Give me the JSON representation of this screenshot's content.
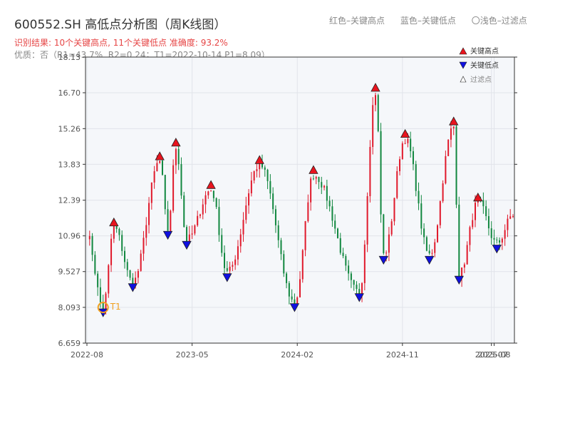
{
  "title": "600552.SH 高低点分析图（周K线图）",
  "subtitle": "识别结果: 10个关键高点, 11个关键低点  准确度: 93.2%",
  "quality_line": "优质：否（R1=43.7%, R2=0.24；T1=2022-10-14 P1=8.09）",
  "color_note": {
    "red": "红色–关键高点",
    "blue": "蓝色–关键低点",
    "light": "〇浅色–过滤点"
  },
  "colors": {
    "up": "#e0192b",
    "down": "#11873f",
    "high_marker": "#e8141e",
    "low_marker": "#1010e0",
    "t1": "#f0a020"
  },
  "chart_data": {
    "type": "candlestick",
    "title": "600552.SH 高低点分析图（周K线图）",
    "ylim": [
      6.659,
      18.13
    ],
    "yticks": [
      "6.659",
      "8.093",
      "9.527",
      "10.96",
      "12.39",
      "13.83",
      "15.26",
      "16.70",
      "18.13"
    ],
    "ytick_values": [
      6.659,
      8.093,
      9.527,
      10.96,
      12.39,
      13.83,
      15.26,
      16.7,
      18.13
    ],
    "xticks": [
      "2022-08",
      "2023-05",
      "2024-02",
      "2024-11",
      "2025-07",
      "2025-08"
    ],
    "xtick_index": [
      0,
      39,
      78,
      117,
      150,
      151
    ],
    "n_weeks": 159,
    "legend": [
      "关键高点",
      "关键低点",
      "过滤点"
    ],
    "legend_position": "top-right",
    "key_highs": [
      {
        "i": 10,
        "value": 11.3
      },
      {
        "i": 27,
        "value": 13.95
      },
      {
        "i": 33,
        "value": 14.5
      },
      {
        "i": 46,
        "value": 12.8
      },
      {
        "i": 64,
        "value": 13.8
      },
      {
        "i": 84,
        "value": 13.4
      },
      {
        "i": 107,
        "value": 16.7
      },
      {
        "i": 118,
        "value": 14.85
      },
      {
        "i": 136,
        "value": 15.35
      },
      {
        "i": 145,
        "value": 12.3
      }
    ],
    "key_lows": [
      {
        "i": 6,
        "value": 8.09
      },
      {
        "i": 17,
        "value": 9.1
      },
      {
        "i": 30,
        "value": 11.2
      },
      {
        "i": 37,
        "value": 10.8
      },
      {
        "i": 52,
        "value": 9.5
      },
      {
        "i": 77,
        "value": 8.3
      },
      {
        "i": 101,
        "value": 8.7
      },
      {
        "i": 110,
        "value": 10.2
      },
      {
        "i": 127,
        "value": 10.2
      },
      {
        "i": 138,
        "value": 9.4
      },
      {
        "i": 152,
        "value": 10.65
      }
    ],
    "t1": {
      "label": "T1",
      "i": 6,
      "value": 8.09,
      "date": "2022-10-14"
    }
  }
}
